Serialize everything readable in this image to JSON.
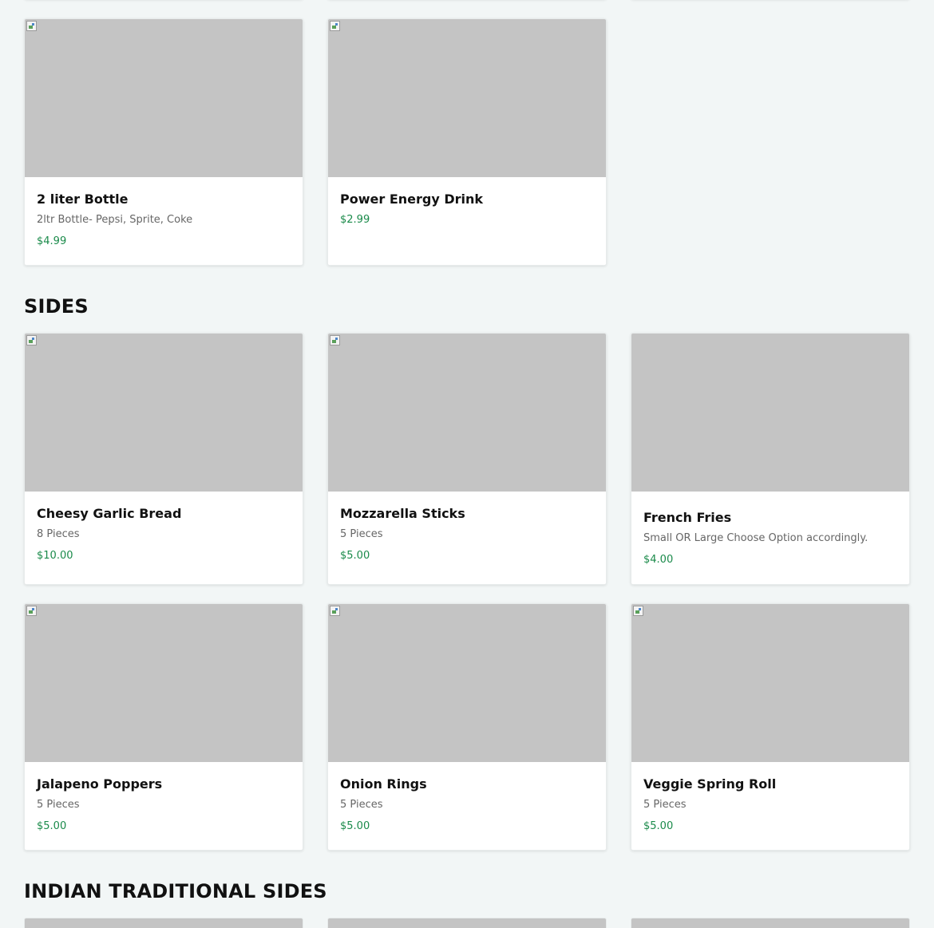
{
  "sections": {
    "drinks_items": [
      {
        "title": "2 liter Bottle",
        "desc": "2ltr Bottle- Pepsi, Sprite, Coke",
        "price": "$4.99"
      },
      {
        "title": "Power Energy Drink",
        "desc": "",
        "price": "$2.99"
      }
    ],
    "sides": {
      "title": "SIDES",
      "items": [
        {
          "title": "Cheesy Garlic Bread",
          "desc": "8 Pieces",
          "price": "$10.00"
        },
        {
          "title": "Mozzarella Sticks",
          "desc": "5 Pieces",
          "price": "$5.00"
        },
        {
          "title": "French Fries",
          "desc": "Small OR Large Choose Option accordingly.",
          "price": "$4.00"
        },
        {
          "title": "Jalapeno Poppers",
          "desc": "5 Pieces",
          "price": "$5.00"
        },
        {
          "title": "Onion Rings",
          "desc": "5 Pieces",
          "price": "$5.00"
        },
        {
          "title": "Veggie Spring Roll",
          "desc": "5 Pieces",
          "price": "$5.00"
        }
      ]
    },
    "indian_traditional_sides": {
      "title": "INDIAN TRADITIONAL SIDES"
    }
  },
  "colors": {
    "background": "#f2f6f6",
    "image_placeholder": "#c4c4c4",
    "price": "#1a8a4a",
    "description": "#666666"
  }
}
